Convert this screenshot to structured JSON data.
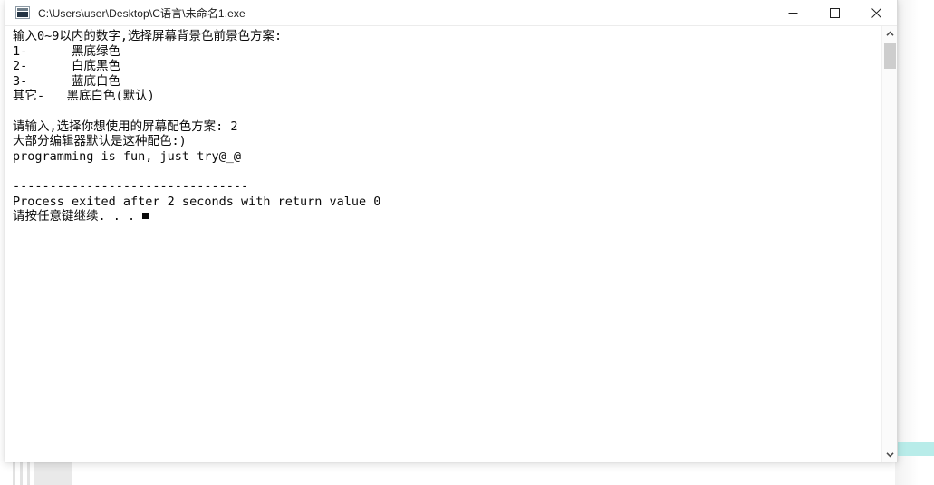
{
  "window": {
    "title": "C:\\Users\\user\\Desktop\\C语言\\未命名1.exe",
    "icon": "console-app-icon",
    "controls": {
      "minimize_label": "Minimize",
      "maximize_label": "Maximize",
      "close_label": "Close"
    }
  },
  "console": {
    "background_color": "#ffffff",
    "foreground_color": "#0a0a0a",
    "lines": [
      "输入0~9以内的数字,选择屏幕背景色前景色方案:",
      "1-      黑底绿色",
      "2-      白底黑色",
      "3-      蓝底白色",
      "其它-   黑底白色(默认)",
      "",
      "请输入,选择你想使用的屏幕配色方案: 2",
      "大部分编辑器默认是这种配色:)",
      "programming is fun, just try@_@",
      "",
      "--------------------------------",
      "Process exited after 2 seconds with return value 0"
    ],
    "final_line_prefix": "请按任意键继续. . . ",
    "input_value": "2",
    "exit_seconds": "2",
    "return_value": "0",
    "cursor": "block-cursor"
  },
  "scrollbar": {
    "up_arrow": "chevron-up-icon",
    "down_arrow": "chevron-down-icon",
    "thumb": "scroll-thumb"
  },
  "desktop": {
    "accent_color": "#b8ece9"
  }
}
